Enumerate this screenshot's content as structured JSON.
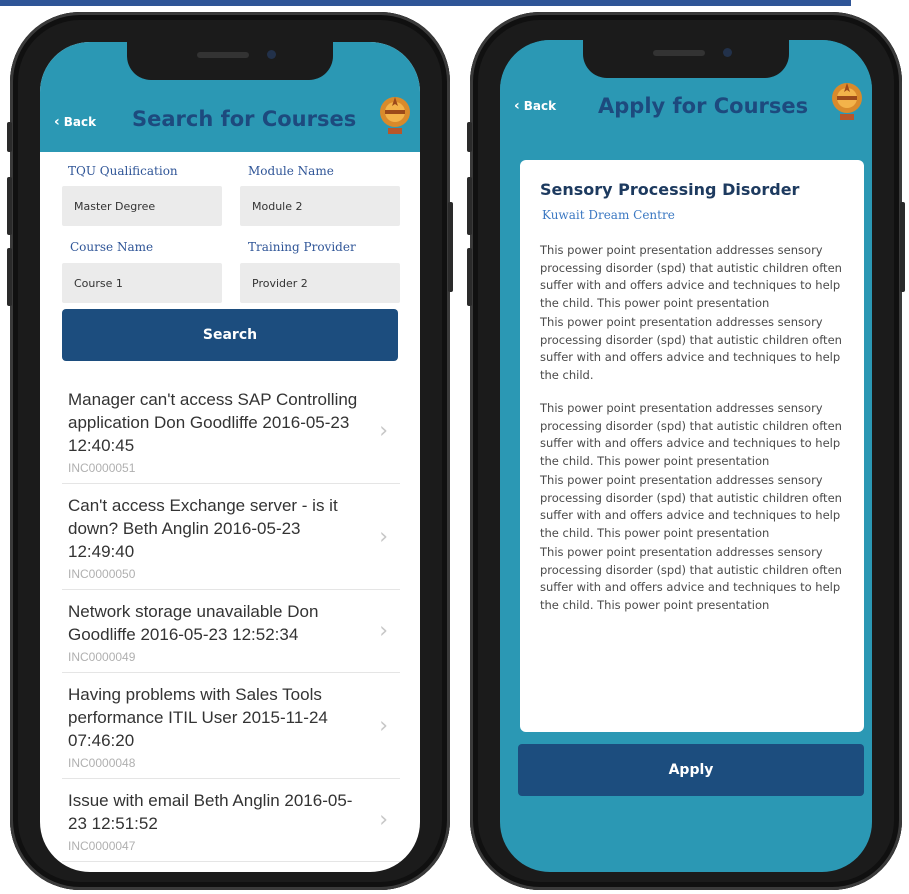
{
  "left_screen": {
    "header": {
      "back_label": "Back",
      "title": "Search for Courses"
    },
    "form": {
      "qualification": {
        "label": "TQU Qualification",
        "value": "Master Degree"
      },
      "module": {
        "label": "Module Name",
        "value": "Module 2"
      },
      "course": {
        "label": "Course Name",
        "value": "Course 1"
      },
      "provider": {
        "label": "Training Provider",
        "value": "Provider 2"
      },
      "search_label": "Search"
    },
    "results": [
      {
        "title": "Manager can't access SAP Controlling application Don Goodliffe 2016-05-23 12:40:45",
        "id": "INC0000051"
      },
      {
        "title": "Can't access Exchange server - is it down? Beth Anglin 2016-05-23 12:49:40",
        "id": "INC0000050"
      },
      {
        "title": "Network storage unavailable Don Goodliffe 2016-05-23 12:52:34",
        "id": "INC0000049"
      },
      {
        "title": "Having problems with Sales Tools performance ITIL User 2015-11-24 07:46:20",
        "id": "INC0000048"
      },
      {
        "title": "Issue with email Beth Anglin 2016-05-23 12:51:52",
        "id": "INC0000047"
      }
    ]
  },
  "right_screen": {
    "header": {
      "back_label": "Back",
      "title": "Apply for Courses"
    },
    "card": {
      "title": "Sensory Processing Disorder",
      "provider": "Kuwait Dream Centre",
      "paragraphs": [
        "This power point presentation addresses sensory processing disorder (spd) that autistic children often suffer with and offers advice and techniques to help the child. This power point presentation",
        "This power point presentation addresses sensory processing disorder (spd) that autistic children often suffer with and offers advice and techniques to help the child.",
        "This power point presentation addresses sensory processing disorder (spd) that autistic children often suffer with and offers advice and techniques to help the child. This power point presentation",
        "This power point presentation addresses sensory processing disorder (spd) that autistic children often suffer with and offers advice and techniques to help the child. This power point presentation",
        "This power point presentation addresses sensory processing disorder (spd) that autistic children often suffer with and offers advice and techniques to help the child. This power point presentation"
      ]
    },
    "apply_label": "Apply"
  },
  "icons": {
    "back": "chevron-left-icon",
    "row": "chevron-right-icon",
    "logo": "emblem-icon"
  },
  "colors": {
    "accent": "#2b98b4",
    "primary_button": "#1c4d7e",
    "title": "#1d4a7e"
  }
}
